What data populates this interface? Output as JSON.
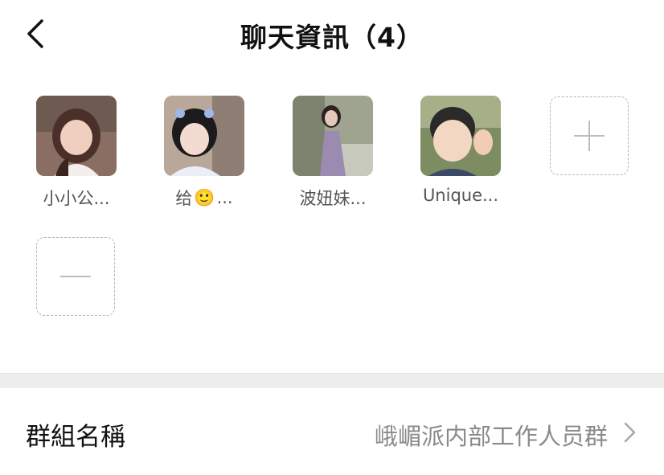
{
  "header": {
    "title": "聊天資訊（4）",
    "back_icon": "chevron-left-icon"
  },
  "members": [
    {
      "name": "小小公...",
      "emoji": ""
    },
    {
      "name": "给",
      "emoji": "🙂",
      "suffix": "..."
    },
    {
      "name": "波妞妹...",
      "emoji": ""
    },
    {
      "name": "Unique...",
      "emoji": ""
    }
  ],
  "actions": {
    "add_icon": "plus-icon",
    "remove_icon": "minus-icon"
  },
  "settings": {
    "group_name_label": "群組名稱",
    "group_name_value": "峨嵋派内部工作人员群",
    "chevron_icon": "chevron-right-icon"
  },
  "colors": {
    "accent_text": "#111111",
    "muted_text": "#8a8a8a",
    "divider": "#ededed"
  }
}
